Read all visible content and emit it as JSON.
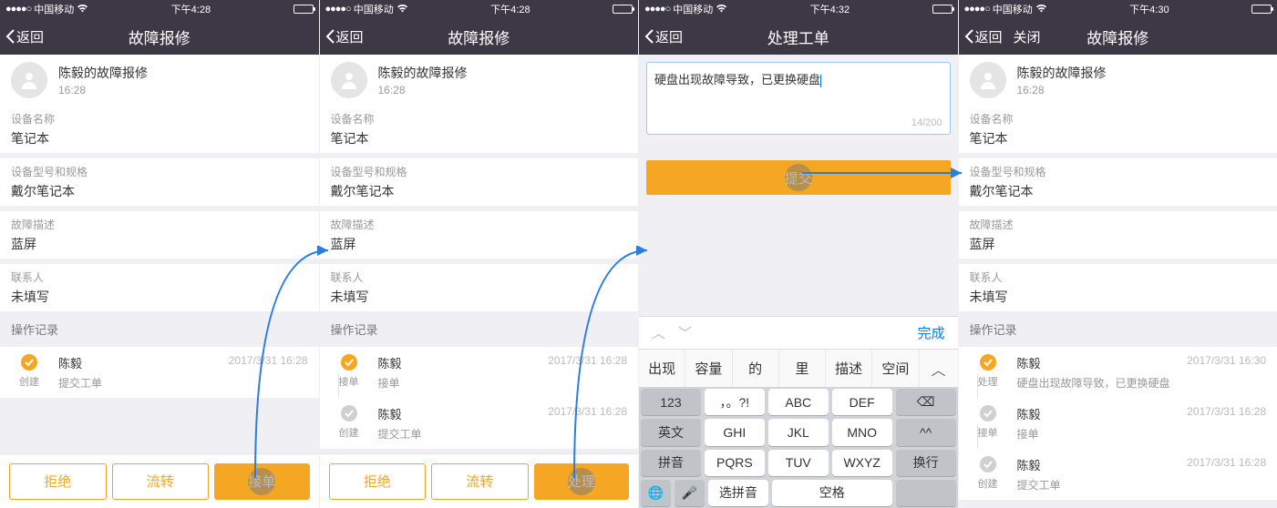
{
  "status": {
    "carrier": "中国移动",
    "signal": "●●●●○"
  },
  "screens": [
    {
      "time": "下午4:28",
      "nav": {
        "back": "返回",
        "title": "故障报修",
        "close": null
      },
      "user": {
        "title": "陈毅的故障报修",
        "time": "16:28"
      },
      "rows": [
        {
          "label": "设备名称",
          "value": "笔记本"
        },
        {
          "label": "设备型号和规格",
          "value": "戴尔笔记本"
        },
        {
          "label": "故障描述",
          "value": "蓝屏"
        },
        {
          "label": "联系人",
          "value": "未填写"
        }
      ],
      "section": "操作记录",
      "logs": [
        {
          "kind": "orange",
          "tag": "创建",
          "name": "陈毅",
          "time": "2017/3/31 16:28",
          "sub": "提交工单"
        }
      ],
      "buttons": [
        {
          "style": "outline",
          "label": "拒绝"
        },
        {
          "style": "outline",
          "label": "流转"
        },
        {
          "style": "fill",
          "label": "接单",
          "touch": true
        }
      ]
    },
    {
      "time": "下午4:28",
      "nav": {
        "back": "返回",
        "title": "故障报修",
        "close": null
      },
      "user": {
        "title": "陈毅的故障报修",
        "time": "16:28"
      },
      "rows": [
        {
          "label": "设备名称",
          "value": "笔记本"
        },
        {
          "label": "设备型号和规格",
          "value": "戴尔笔记本"
        },
        {
          "label": "故障描述",
          "value": "蓝屏"
        },
        {
          "label": "联系人",
          "value": "未填写"
        }
      ],
      "section": "操作记录",
      "logs": [
        {
          "kind": "orange",
          "tag": "接单",
          "name": "陈毅",
          "time": "2017/3/31 16:28",
          "sub": "接单"
        },
        {
          "kind": "gray",
          "tag": "创建",
          "name": "陈毅",
          "time": "2017/3/31 16:28",
          "sub": "提交工单"
        }
      ],
      "buttons": [
        {
          "style": "outline",
          "label": "拒绝"
        },
        {
          "style": "outline",
          "label": "流转"
        },
        {
          "style": "fill",
          "label": "处理",
          "touch": true
        }
      ]
    },
    {
      "time": "下午4:32",
      "nav": {
        "back": "返回",
        "title": "处理工单",
        "close": null
      },
      "textarea": {
        "text": "硬盘出现故障导致，已更换硬盘",
        "counter": "14/200"
      },
      "submit": "提交",
      "accessory_done": "完成",
      "candidates": [
        "出现",
        "容量",
        "的",
        "里",
        "描述",
        "空间"
      ],
      "keyboard": [
        [
          "123",
          "，。?!",
          "ABC",
          "DEF",
          "⌫"
        ],
        [
          "英文",
          "GHI",
          "JKL",
          "MNO",
          "^^"
        ],
        [
          "拼音",
          "PQRS",
          "TUV",
          "WXYZ",
          "换行"
        ],
        [
          "🌐",
          "🎤",
          "选拼音",
          "空格",
          ""
        ]
      ]
    },
    {
      "time": "下午4:30",
      "nav": {
        "back": "返回",
        "title": "故障报修",
        "close": "关闭"
      },
      "user": {
        "title": "陈毅的故障报修",
        "time": "16:28"
      },
      "rows": [
        {
          "label": "设备名称",
          "value": "笔记本"
        },
        {
          "label": "设备型号和规格",
          "value": "戴尔笔记本"
        },
        {
          "label": "故障描述",
          "value": "蓝屏"
        },
        {
          "label": "联系人",
          "value": "未填写"
        }
      ],
      "section": "操作记录",
      "logs": [
        {
          "kind": "orange",
          "tag": "处理",
          "name": "陈毅",
          "time": "2017/3/31 16:30",
          "sub": "硬盘出现故障导致，已更换硬盘"
        },
        {
          "kind": "gray",
          "tag": "接单",
          "name": "陈毅",
          "time": "2017/3/31 16:28",
          "sub": "接单"
        },
        {
          "kind": "gray",
          "tag": "创建",
          "name": "陈毅",
          "time": "2017/3/31 16:28",
          "sub": "提交工单"
        }
      ],
      "buttons": []
    }
  ]
}
